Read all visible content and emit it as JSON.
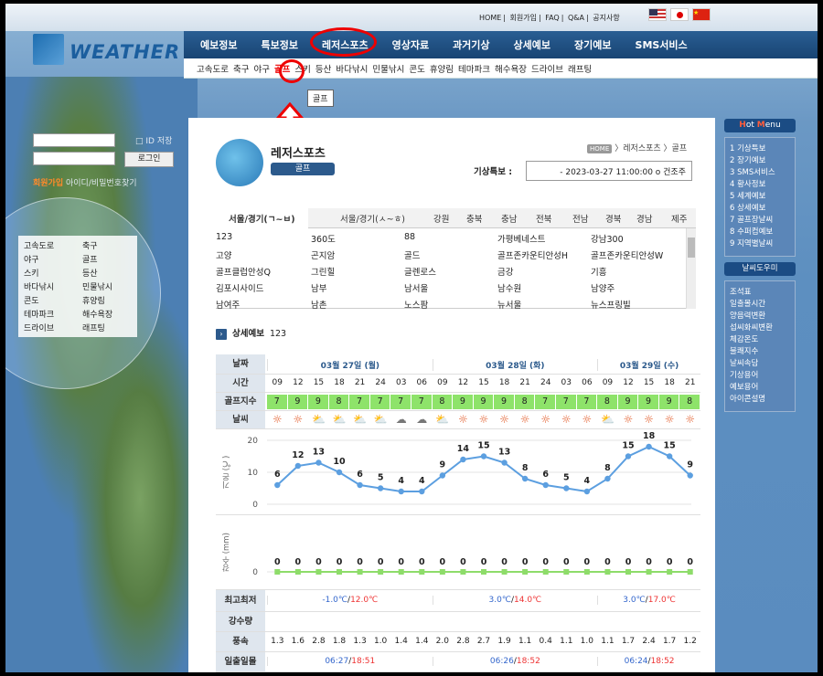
{
  "top_links": [
    "HOME",
    "회원가입",
    "FAQ",
    "Q&A",
    "공지사항"
  ],
  "logo": {
    "text": "WEATHER"
  },
  "main_nav": [
    "예보정보",
    "특보정보",
    "레저스포츠",
    "영상자료",
    "과거기상",
    "상세예보",
    "장기예보",
    "SMS서비스"
  ],
  "sub_nav": [
    "고속도로",
    "축구",
    "야구",
    "골프",
    "스키",
    "등산",
    "바다낚시",
    "민물낚시",
    "콘도",
    "휴양림",
    "테마파크",
    "해수욕장",
    "드라이브",
    "래프팅"
  ],
  "tooltip": "골프",
  "login": {
    "id_save": "ID 저장",
    "button": "로그인",
    "join": "회원가입",
    "find": "아이디/비밀번호찾기"
  },
  "side_menu": [
    "고속도로",
    "축구",
    "야구",
    "골프",
    "스키",
    "등산",
    "바다낚시",
    "민물낚시",
    "콘도",
    "휴양림",
    "테마파크",
    "해수욕장",
    "드라이브",
    "래프팅"
  ],
  "section": {
    "title": "레저스포츠",
    "tag": "골프"
  },
  "breadcrumb": {
    "home": "HOME",
    "items": [
      "레저스포츠",
      "골프"
    ]
  },
  "special_report": {
    "label": "기상특보 :",
    "value": "- 2023-03-27 11:00:00 o 건조주"
  },
  "region_tabs": [
    "서울/경기(ㄱ~ㅂ)",
    "서울/경기(ㅅ~ㅎ)",
    "강원",
    "충북",
    "충남",
    "전북",
    "전남",
    "경북",
    "경남",
    "제주"
  ],
  "courses": [
    [
      "123",
      "360도",
      "88",
      "가평베네스트",
      "강남300"
    ],
    [
      "고양",
      "곤지암",
      "골드",
      "골프존카운티안성H",
      "골프존카운티안성W"
    ],
    [
      "골프클럽안성Q",
      "그린힐",
      "글렌로스",
      "금강",
      "기흥"
    ],
    [
      "김포시사이드",
      "남부",
      "남서울",
      "남수원",
      "남양주"
    ],
    [
      "남여주",
      "남촌",
      "노스팜",
      "뉴서울",
      "뉴스프링빌"
    ]
  ],
  "detail": {
    "label": "상세예보",
    "course": "123"
  },
  "forecast": {
    "labels": {
      "date": "날짜",
      "time": "시간",
      "golf": "골프지수",
      "weather": "날씨",
      "temp_axis": "기온 (℃)",
      "rain_axis": "강수 (mm)",
      "minmax": "최고최저",
      "precip": "강수량",
      "wind": "풍속",
      "sun": "일출일몰"
    },
    "days": [
      {
        "date": "03월 27일 (월)",
        "min": "-1.0℃",
        "max": "12.0℃",
        "sunrise": "06:27",
        "sunset": "18:51"
      },
      {
        "date": "03월 28일 (화)",
        "min": "3.0℃",
        "max": "14.0℃",
        "sunrise": "06:26",
        "sunset": "18:52"
      },
      {
        "date": "03월 29일 (수)",
        "min": "3.0℃",
        "max": "17.0℃",
        "sunrise": "06:24",
        "sunset": "18:52"
      }
    ],
    "times": [
      "09",
      "12",
      "15",
      "18",
      "21",
      "24",
      "03",
      "06",
      "09",
      "12",
      "15",
      "18",
      "21",
      "24",
      "03",
      "06",
      "09",
      "12",
      "15",
      "18",
      "21"
    ],
    "golf_index": [
      "7",
      "9",
      "9",
      "8",
      "7",
      "7",
      "7",
      "7",
      "8",
      "9",
      "9",
      "9",
      "8",
      "7",
      "7",
      "7",
      "8",
      "9",
      "9",
      "9",
      "8"
    ],
    "weather_icons": [
      "sun",
      "sun",
      "partly-cloudy",
      "partly-cloudy",
      "partly-cloudy",
      "partly-cloudy",
      "cloudy",
      "cloudy",
      "partly-cloudy",
      "sun",
      "sun",
      "sun",
      "sun",
      "sun",
      "sun",
      "sun",
      "partly-cloudy",
      "sun",
      "sun",
      "sun",
      "sun"
    ],
    "wind": [
      "1.3",
      "1.6",
      "2.8",
      "1.8",
      "1.3",
      "1.0",
      "1.4",
      "1.4",
      "2.0",
      "2.8",
      "2.7",
      "1.9",
      "1.1",
      "0.4",
      "1.1",
      "1.0",
      "1.1",
      "1.7",
      "2.4",
      "1.7",
      "1.2"
    ],
    "colors": {
      "line": "#5c9fe0",
      "rain": "#8edc6a",
      "max": "#e33",
      "min": "#3366cc",
      "golf": "#8ee36a"
    }
  },
  "chart_data": [
    {
      "type": "line",
      "xlabel": "",
      "ylabel": "기온 (℃)",
      "ylim": [
        0,
        20
      ],
      "yticks": [
        0,
        10,
        20
      ],
      "x": [
        "09",
        "12",
        "15",
        "18",
        "21",
        "24",
        "03",
        "06",
        "09",
        "12",
        "15",
        "18",
        "21",
        "24",
        "03",
        "06",
        "09",
        "12",
        "15",
        "18",
        "21"
      ],
      "series": [
        {
          "values": [
            6,
            12,
            13,
            10,
            6,
            5,
            4,
            4,
            9,
            14,
            15,
            13,
            8,
            6,
            5,
            4,
            8,
            15,
            18,
            15,
            9
          ]
        }
      ]
    },
    {
      "type": "line",
      "xlabel": "",
      "ylabel": "강수 (mm)",
      "yticks": [
        0
      ],
      "x": [
        "09",
        "12",
        "15",
        "18",
        "21",
        "24",
        "03",
        "06",
        "09",
        "12",
        "15",
        "18",
        "21",
        "24",
        "03",
        "06",
        "09",
        "12",
        "15",
        "18",
        "21"
      ],
      "series": [
        {
          "values": [
            0,
            0,
            0,
            0,
            0,
            0,
            0,
            0,
            0,
            0,
            0,
            0,
            0,
            0,
            0,
            0,
            0,
            0,
            0,
            0,
            0
          ]
        }
      ]
    }
  ],
  "right_menu": {
    "hot_title_a": "H",
    "hot_title_b": "ot",
    "hot_title_c": "M",
    "hot_title_d": "enu",
    "hot": [
      "1 기상특보",
      "2 장기예보",
      "3 SMS서비스",
      "4 황사정보",
      "5 세계예보",
      "6 상세예보",
      "7 골프장날씨",
      "8 수퍼컴예보",
      "9 지역별날씨"
    ],
    "helper_title": "날씨도우미",
    "helper": [
      "조석표",
      "일출몰시간",
      "양음력변환",
      "섭씨화씨변환",
      "체감온도",
      "불쾌지수",
      "날씨속담",
      "기상용어",
      "예보용어",
      "아이콘설명"
    ]
  }
}
